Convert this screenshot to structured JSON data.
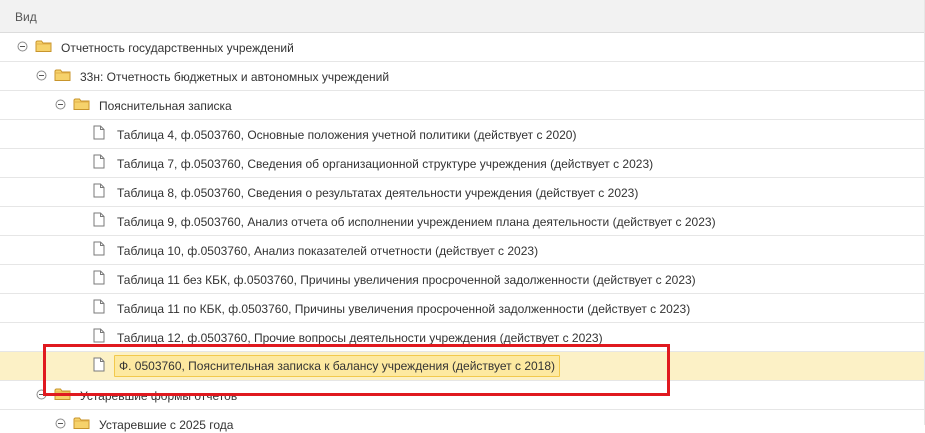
{
  "header": {
    "column_label": "Вид"
  },
  "tree": {
    "rows": [
      {
        "label": "Отчетность государственных учреждений",
        "icon": "folder-icon",
        "level": 0,
        "toggle": "expanded"
      },
      {
        "label": "33н: Отчетность бюджетных и автономных учреждений",
        "icon": "folder-icon",
        "level": 1,
        "toggle": "expanded"
      },
      {
        "label": "Пояснительная записка",
        "icon": "folder-icon",
        "level": 2,
        "toggle": "expanded"
      },
      {
        "label": "Таблица  4, ф.0503760, Основные положения учетной политики (действует с 2020)",
        "icon": "document-icon",
        "level": 3
      },
      {
        "label": "Таблица  7, ф.0503760, Сведения об организационной структуре учреждения (действует с 2023)",
        "icon": "document-icon",
        "level": 3
      },
      {
        "label": "Таблица  8, ф.0503760, Сведения о результатах деятельности учреждения (действует с 2023)",
        "icon": "document-icon",
        "level": 3
      },
      {
        "label": "Таблица  9, ф.0503760, Анализ отчета об исполнении учреждением плана деятельности (действует с 2023)",
        "icon": "document-icon",
        "level": 3
      },
      {
        "label": "Таблица 10, ф.0503760, Анализ показателей отчетности (действует с 2023)",
        "icon": "document-icon",
        "level": 3
      },
      {
        "label": "Таблица 11 без КБК, ф.0503760, Причины увеличения просроченной задолженности (действует с 2023)",
        "icon": "document-icon",
        "level": 3
      },
      {
        "label": "Таблица 11 по КБК, ф.0503760, Причины увеличения просроченной задолженности (действует с 2023)",
        "icon": "document-icon",
        "level": 3
      },
      {
        "label": "Таблица 12, ф.0503760, Прочие вопросы деятельности учреждения (действует с 2023)",
        "icon": "document-icon",
        "level": 3
      },
      {
        "label": "Ф. 0503760, Пояснительная записка к балансу учреждения (действует с 2018)",
        "icon": "document-icon",
        "level": 3,
        "selected": true
      },
      {
        "label": "Устаревшие формы отчетов",
        "icon": "folder-icon",
        "level": 1,
        "toggle": "expanded"
      },
      {
        "label": "Устаревшие с 2025 года",
        "icon": "folder-icon",
        "level": 2,
        "toggle": "expanded"
      }
    ]
  },
  "colors": {
    "selection_background": "#fcf1c6",
    "selected_label_background": "#fde9a0",
    "highlight_frame": "#e0191f",
    "folder": "#f0c245"
  }
}
